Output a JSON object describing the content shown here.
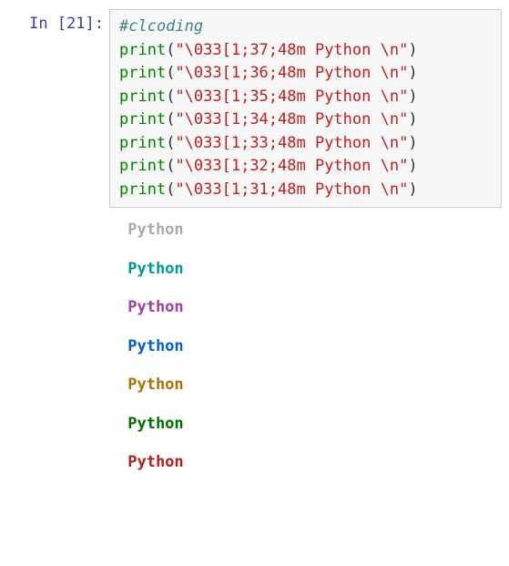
{
  "prompt": {
    "label": "In [21]:"
  },
  "code": {
    "comment": "#clcoding",
    "func": "print",
    "lp": "(",
    "rp": ")",
    "lines": [
      {
        "str": "\"\\033[1;37;48m Python \\n\""
      },
      {
        "str": "\"\\033[1;36;48m Python \\n\""
      },
      {
        "str": "\"\\033[1;35;48m Python \\n\""
      },
      {
        "str": "\"\\033[1;34;48m Python \\n\""
      },
      {
        "str": "\"\\033[1;33;48m Python \\n\""
      },
      {
        "str": "\"\\033[1;32;48m Python \\n\""
      },
      {
        "str": "\"\\033[1;31;48m Python \\n\""
      }
    ]
  },
  "output": {
    "lines": [
      {
        "cls": "o37",
        "text": " Python "
      },
      {
        "cls": "o36",
        "text": " Python "
      },
      {
        "cls": "o35",
        "text": " Python "
      },
      {
        "cls": "o34",
        "text": " Python "
      },
      {
        "cls": "o33",
        "text": " Python "
      },
      {
        "cls": "o32",
        "text": " Python "
      },
      {
        "cls": "o31",
        "text": " Python "
      }
    ]
  }
}
